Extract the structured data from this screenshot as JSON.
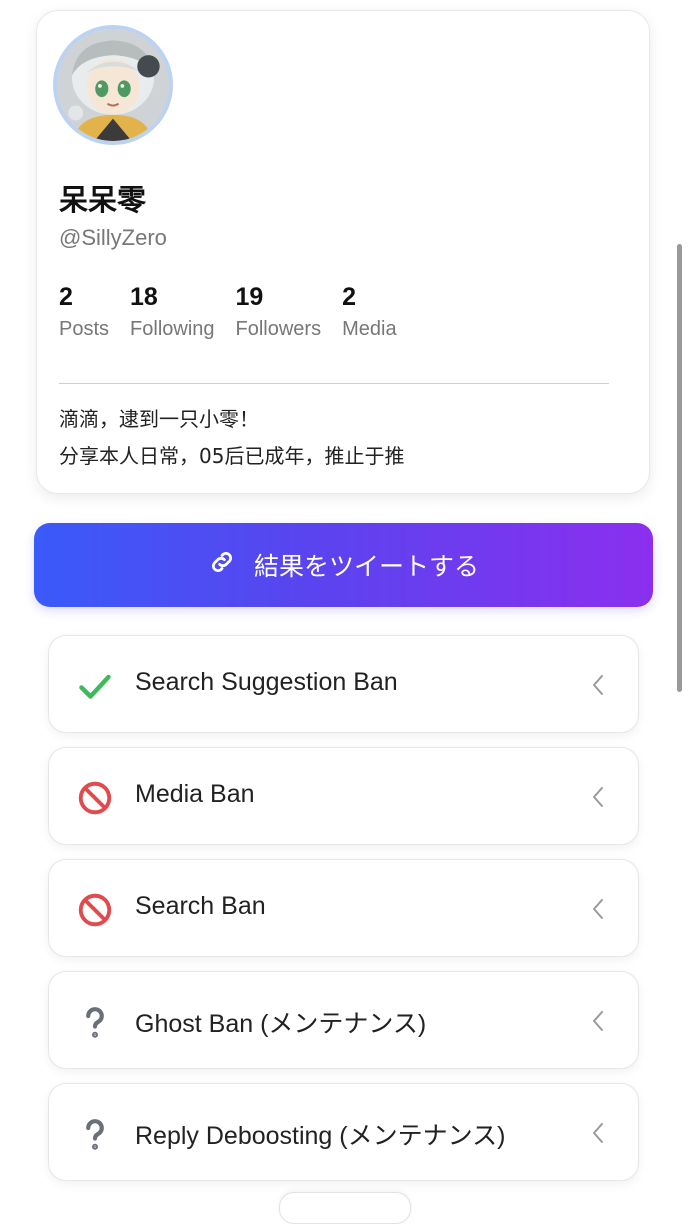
{
  "profile": {
    "display_name": "呆呆零",
    "handle": "@SillyZero",
    "stats": [
      {
        "value": "2",
        "label": "Posts"
      },
      {
        "value": "18",
        "label": "Following"
      },
      {
        "value": "19",
        "label": "Followers"
      },
      {
        "value": "2",
        "label": "Media"
      }
    ],
    "bio_lines": [
      "滴滴，逮到一只小零！",
      "分享本人日常，05后已成年，推止于推"
    ]
  },
  "tweet_button": {
    "label": "結果をツイートする",
    "icon": "link-icon"
  },
  "ban_checks": [
    {
      "label": "Search Suggestion Ban",
      "status": "ok",
      "icon": "checkmark-icon",
      "color": "#3fba5a"
    },
    {
      "label": "Media Ban",
      "status": "banned",
      "icon": "prohibited-icon",
      "color": "#e14b4b"
    },
    {
      "label": "Search Ban",
      "status": "banned",
      "icon": "prohibited-icon",
      "color": "#e14b4b"
    },
    {
      "label": "Ghost Ban (メンテナンス)",
      "status": "unknown",
      "icon": "question-icon",
      "color": "#6a6f78"
    },
    {
      "label": "Reply Deboosting (メンテナンス)",
      "status": "unknown",
      "icon": "question-icon",
      "color": "#6a6f78"
    }
  ],
  "colors": {
    "gradient_start": "#3a5af9",
    "gradient_end": "#8b2fee",
    "avatar_ring": "#bcd2f3"
  }
}
